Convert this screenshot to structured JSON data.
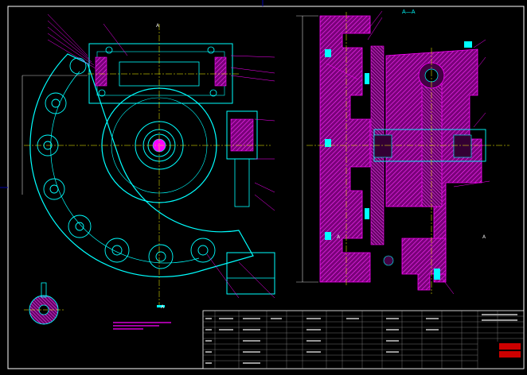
{
  "drawing": {
    "section_label": "A—A",
    "view_marks": [
      "A",
      "A",
      "A",
      "A"
    ],
    "colors": {
      "background": "#000000",
      "border": "#ffffff",
      "outline": "#00ffff",
      "hatch": "#ff00ff",
      "centerline": "#ffff00",
      "leader": "#ff00ff",
      "title_stamp": "#cc0000"
    },
    "title_block": {
      "stamp_label": "",
      "stamp_label_2": ""
    }
  }
}
